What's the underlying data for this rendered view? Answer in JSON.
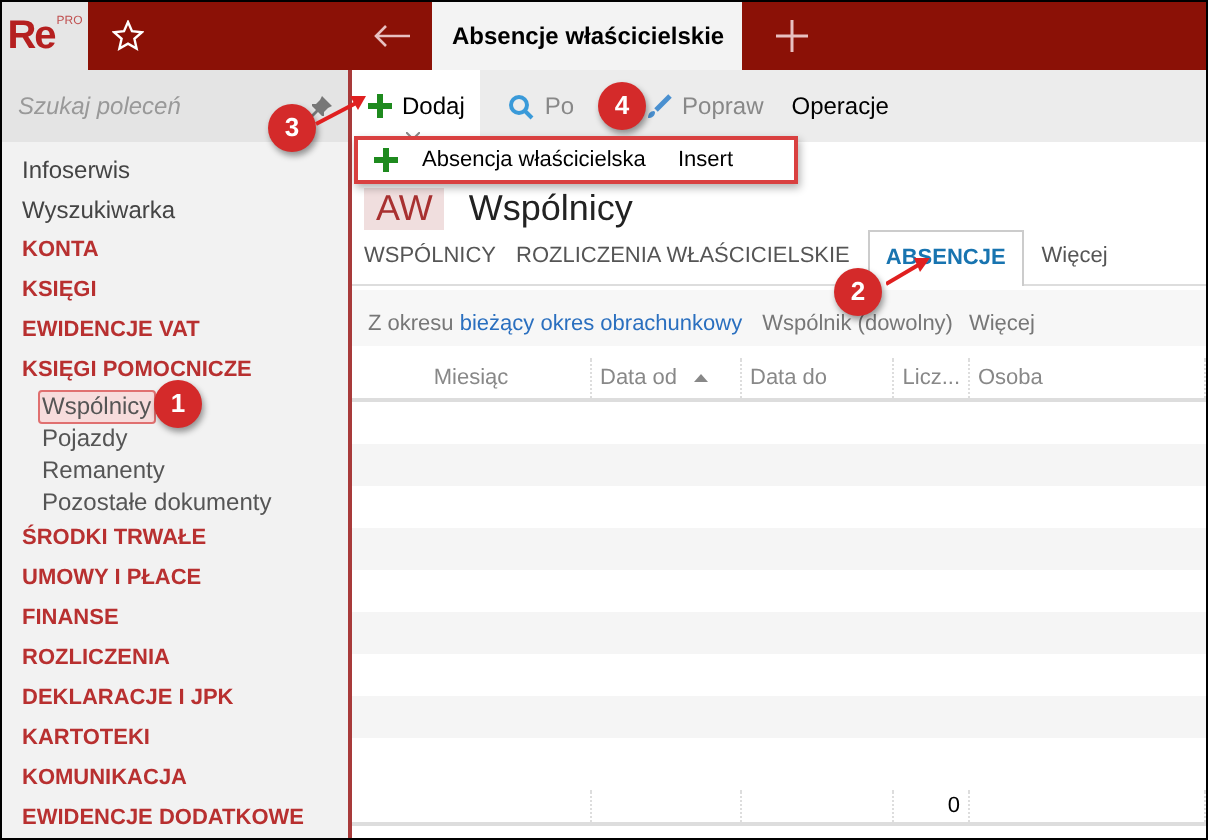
{
  "app": {
    "logo": "Re",
    "logo_badge": "PRO"
  },
  "tab_title": "Absencje właścicielskie",
  "sidebar": {
    "search": {
      "placeholder": "Szukaj poleceń"
    },
    "items": [
      {
        "label": "Infoserwis",
        "kind": "link"
      },
      {
        "label": "Wyszukiwarka",
        "kind": "link"
      },
      {
        "label": "KONTA",
        "kind": "category"
      },
      {
        "label": "KSIĘGI",
        "kind": "category"
      },
      {
        "label": "EWIDENCJE VAT",
        "kind": "category"
      },
      {
        "label": "KSIĘGI POMOCNICZE",
        "kind": "category",
        "children": [
          {
            "label": "Wspólnicy",
            "selected": true
          },
          {
            "label": "Pojazdy",
            "selected": false
          },
          {
            "label": "Remanenty",
            "selected": false
          },
          {
            "label": "Pozostałe dokumenty",
            "selected": false
          }
        ]
      },
      {
        "label": "ŚRODKI TRWAŁE",
        "kind": "category"
      },
      {
        "label": "UMOWY I PŁACE",
        "kind": "category"
      },
      {
        "label": "FINANSE",
        "kind": "category"
      },
      {
        "label": "ROZLICZENIA",
        "kind": "category"
      },
      {
        "label": "DEKLARACJE I JPK",
        "kind": "category"
      },
      {
        "label": "KARTOTEKI",
        "kind": "category"
      },
      {
        "label": "KOMUNIKACJA",
        "kind": "category"
      },
      {
        "label": "EWIDENCJE DODATKOWE",
        "kind": "category"
      }
    ]
  },
  "toolbar": [
    {
      "label": "Dodaj",
      "kind": "add",
      "active": true,
      "disabled": false
    },
    {
      "label": "Po",
      "kind": "search",
      "active": false,
      "disabled": true
    },
    {
      "label": "Popraw",
      "kind": "edit",
      "active": false,
      "disabled": true
    },
    {
      "label": "Operacje",
      "kind": "plain",
      "active": false,
      "disabled": false
    }
  ],
  "dropdown": {
    "label": "Absencja właścicielska",
    "shortcut": "Insert"
  },
  "header": {
    "initials": "AW",
    "title": "Wspólnicy"
  },
  "tabs": [
    {
      "label": "WSPÓLNICY",
      "selected": false
    },
    {
      "label": "ROZLICZENIA WŁAŚCICIELSKIE",
      "selected": false
    },
    {
      "label": "ABSENCJE",
      "selected": true
    },
    {
      "label": "Więcej",
      "selected": false
    }
  ],
  "filter": {
    "prefix": "Z okresu",
    "period": "bieżący okres obrachunkowy",
    "partner": "Wspólnik (dowolny)",
    "more": "Więcej"
  },
  "table": {
    "columns": [
      {
        "label": "Miesiąc",
        "sorted": false
      },
      {
        "label": "Data od",
        "sorted": true
      },
      {
        "label": "Data do",
        "sorted": false
      },
      {
        "label": "Licz...",
        "sorted": false
      },
      {
        "label": "Osoba",
        "sorted": false
      }
    ],
    "count_total": "0"
  },
  "annotations": [
    "1",
    "2",
    "3",
    "4"
  ]
}
